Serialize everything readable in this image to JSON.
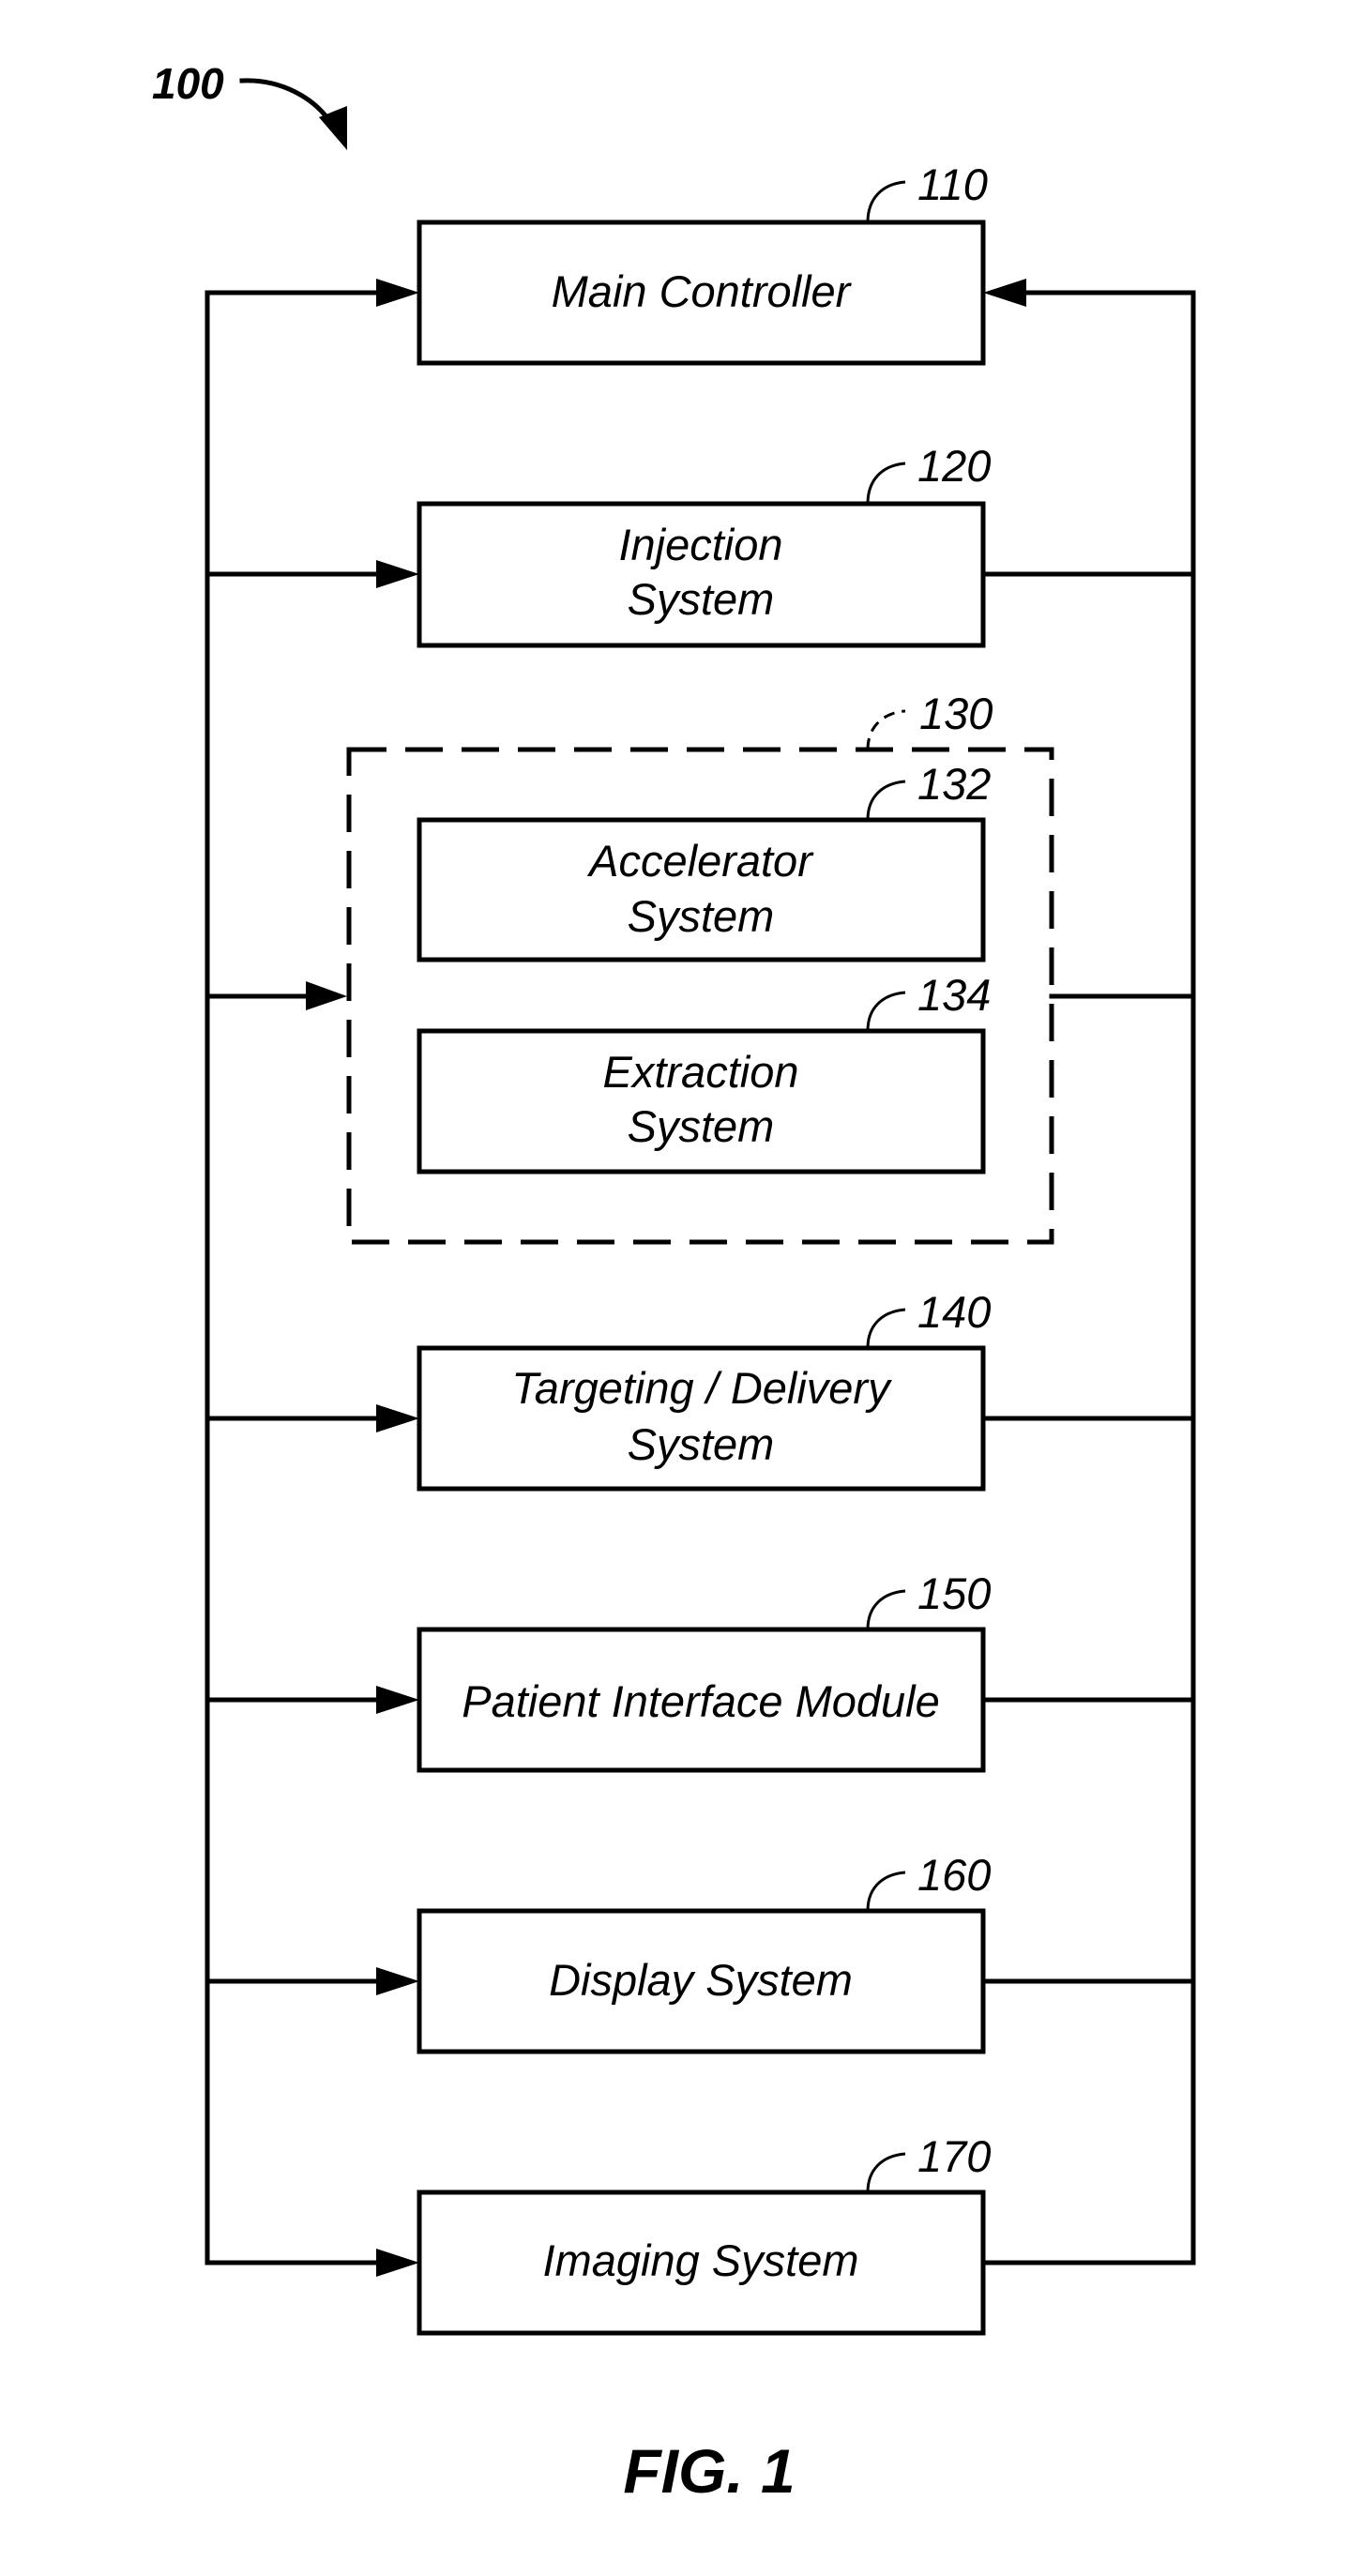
{
  "figure": {
    "caption": "FIG. 1",
    "system_ref": "100"
  },
  "blocks": {
    "main_controller": {
      "ref": "110",
      "lines": [
        "Main Controller"
      ]
    },
    "injection": {
      "ref": "120",
      "lines": [
        "Injection",
        "System"
      ]
    },
    "accel_extract_group": {
      "ref": "130"
    },
    "accelerator": {
      "ref": "132",
      "lines": [
        "Accelerator",
        "System"
      ]
    },
    "extraction": {
      "ref": "134",
      "lines": [
        "Extraction",
        "System"
      ]
    },
    "targeting": {
      "ref": "140",
      "lines": [
        "Targeting / Delivery",
        "System"
      ]
    },
    "patient_interface": {
      "ref": "150",
      "lines": [
        "Patient Interface Module"
      ]
    },
    "display": {
      "ref": "160",
      "lines": [
        "Display System"
      ]
    },
    "imaging": {
      "ref": "170",
      "lines": [
        "Imaging System"
      ]
    }
  },
  "connections": {
    "left_bus": "Main Controller output to all subsystems (arrows into each block)",
    "right_bus": "All subsystems feed back to Main Controller (arrow into Main Controller)"
  }
}
